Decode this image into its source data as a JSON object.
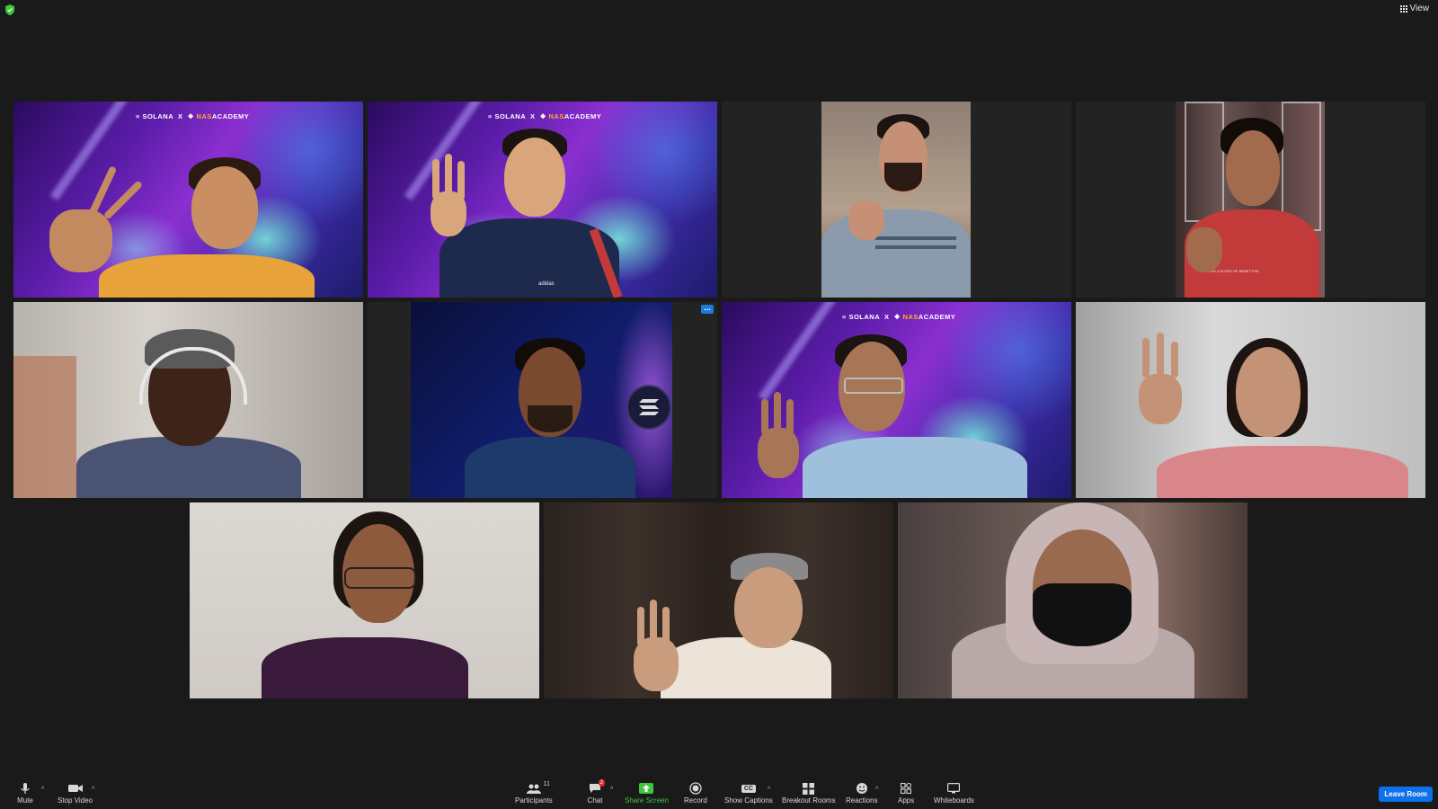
{
  "top_bar": {
    "view_label": "View"
  },
  "tiles": [
    {
      "brand": {
        "solana": "SOLANA",
        "x": "X",
        "nas": "NAS",
        "academy": "ACADEMY"
      }
    },
    {
      "brand": {
        "solana": "SOLANA",
        "x": "X",
        "nas": "NAS",
        "academy": "ACADEMY"
      }
    },
    {},
    {},
    {},
    {
      "more_label": "..."
    },
    {
      "brand": {
        "solana": "SOLANA",
        "x": "X",
        "nas": "NAS",
        "academy": "ACADEMY"
      }
    },
    {},
    {},
    {},
    {}
  ],
  "shirt_text": {
    "adidas": "adidas",
    "united": "UNITED COLORS OF BENETTON"
  },
  "toolbar": {
    "mute": "Mute",
    "stop_video": "Stop Video",
    "participants": "Participants",
    "participant_count": "11",
    "chat": "Chat",
    "chat_badge": "2",
    "share_screen": "Share Screen",
    "record": "Record",
    "show_captions": "Show Captions",
    "captions_icon_text": "CC",
    "breakout_rooms": "Breakout Rooms",
    "reactions": "Reactions",
    "apps": "Apps",
    "whiteboards": "Whiteboards",
    "leave_room": "Leave Room"
  },
  "colors": {
    "active_speaker_border": "#3fc63f",
    "share_green": "#3fc63f",
    "leave_blue": "#0e71eb",
    "background": "#1a1a1a"
  }
}
